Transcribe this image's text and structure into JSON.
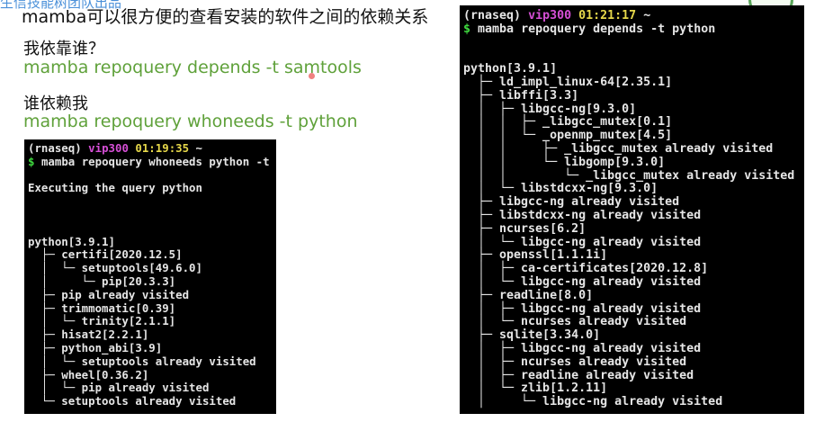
{
  "watermark": "生信技能树团队出品",
  "slide": {
    "title": "mamba可以很方便的查看安装的软件之间的依赖关系",
    "q1_heading": "我依靠谁？",
    "q1_command": "mamba repoquery depends -t samtools",
    "q2_heading": "谁依赖我",
    "q2_command": "mamba repoquery whoneeds -t python"
  },
  "terminal_left": {
    "prompt": {
      "env": "(rnaseq)",
      "host": "vip300",
      "time": "01:19:35",
      "tilde": "~"
    },
    "command": "mamba repoquery whoneeds python -t",
    "lines": [
      "",
      "Executing the query python",
      "",
      "",
      "",
      "python[3.9.1]",
      "  ├─ certifi[2020.12.5]",
      "  │  └─ setuptools[49.6.0]",
      "  │     └─ pip[20.3.3]",
      "  ├─ pip already visited",
      "  ├─ trimmomatic[0.39]",
      "  │  └─ trinity[2.1.1]",
      "  ├─ hisat2[2.2.1]",
      "  ├─ python_abi[3.9]",
      "  │  └─ setuptools already visited",
      "  ├─ wheel[0.36.2]",
      "  │  └─ pip already visited",
      "  └─ setuptools already visited"
    ]
  },
  "terminal_right": {
    "prompt": {
      "env": "(rnaseq)",
      "host": "vip300",
      "time": "01:21:17",
      "tilde": "~"
    },
    "command": "mamba repoquery depends -t python",
    "lines": [
      "",
      "",
      "python[3.9.1]",
      "  ├─ ld_impl_linux-64[2.35.1]",
      "  ├─ libffi[3.3]",
      "  │  ├─ libgcc-ng[9.3.0]",
      "  │  │  ├─ _libgcc_mutex[0.1]",
      "  │  │  └─ _openmp_mutex[4.5]",
      "  │  │     ├─ _libgcc_mutex already visited",
      "  │  │     └─ libgomp[9.3.0]",
      "  │  │        └─ _libgcc_mutex already visited",
      "  │  └─ libstdcxx-ng[9.3.0]",
      "  ├─ libgcc-ng already visited",
      "  ├─ libstdcxx-ng already visited",
      "  ├─ ncurses[6.2]",
      "  │  └─ libgcc-ng already visited",
      "  ├─ openssl[1.1.1i]",
      "  │  ├─ ca-certificates[2020.12.8]",
      "  │  └─ libgcc-ng already visited",
      "  ├─ readline[8.0]",
      "  │  ├─ libgcc-ng already visited",
      "  │  └─ ncurses already visited",
      "  ├─ sqlite[3.34.0]",
      "  │  ├─ libgcc-ng already visited",
      "  │  ├─ ncurses already visited",
      "  │  ├─ readline already visited",
      "  │  └─ zlib[1.2.11]",
      "  │     └─ libgcc-ng already visited"
    ]
  }
}
